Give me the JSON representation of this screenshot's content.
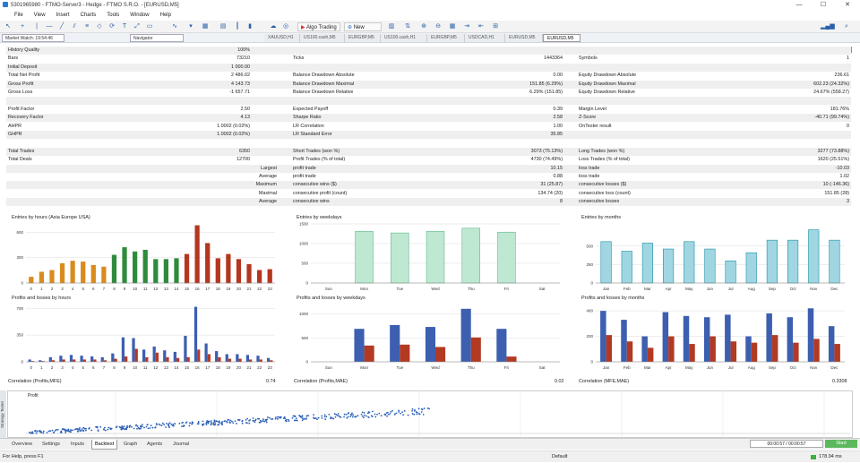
{
  "window": {
    "title": "5301965980 - FTMO-Server3 - Hedge - FTMO S.R.O. - [EURUSD,M5]",
    "controls": [
      "—",
      "☐",
      "✕"
    ]
  },
  "menu": [
    "File",
    "View",
    "Insert",
    "Charts",
    "Tools",
    "Window",
    "Help"
  ],
  "toolbar": {
    "algo_trading": "Algo Trading",
    "new_order": "New Order"
  },
  "panes": {
    "market_watch": "Market Watch: 19:54:46",
    "navigator": "Navigator"
  },
  "chart_tabs": [
    "XAUUSD,H1",
    "US100.cash,M5",
    "EURGBP,M5",
    "US100.cash,H1",
    "EURGBP,M5",
    "USDCAD,H1",
    "EURUSD,M5",
    "EURUSD,M5"
  ],
  "active_chart_tab": 7,
  "report": {
    "rows": [
      {
        "c1": [
          "History Quality",
          "100%"
        ],
        "c2": [
          "",
          ""
        ],
        "c3": [
          "",
          ""
        ]
      },
      {
        "c1": [
          "Bars",
          "73210"
        ],
        "c2": [
          "Ticks",
          "1443364"
        ],
        "c3": [
          "Symbols",
          "1"
        ]
      },
      {
        "c1": [
          "Initial Deposit",
          "1 000.00"
        ],
        "c2": [
          "",
          ""
        ],
        "c3": [
          "",
          ""
        ]
      },
      {
        "c1": [
          "Total Net Profit",
          "2 486.02"
        ],
        "c2": [
          "Balance Drawdown Absolute",
          "0.00"
        ],
        "c3": [
          "Equity Drawdown Absolute",
          "236.61"
        ]
      },
      {
        "c1": [
          "Gross Profit",
          "4 143.73"
        ],
        "c2": [
          "Balance Drawdown Maximal",
          "151.85 (6.29%)"
        ],
        "c3": [
          "Equity Drawdown Maximal",
          "602.23 (24.32%)"
        ]
      },
      {
        "c1": [
          "Gross Loss",
          "-1 657.71"
        ],
        "c2": [
          "Balance Drawdown Relative",
          "6.29% (151.85)"
        ],
        "c3": [
          "Equity Drawdown Relative",
          "24.67% (558.27)"
        ]
      },
      {
        "c1": [
          "",
          ""
        ],
        "c2": [
          "",
          ""
        ],
        "c3": [
          "",
          ""
        ]
      },
      {
        "c1": [
          "Profit Factor",
          "2.50"
        ],
        "c2": [
          "Expected Payoff",
          "0.39"
        ],
        "c3": [
          "Margin Level",
          "181.76%"
        ]
      },
      {
        "c1": [
          "Recovery Factor",
          "4.13"
        ],
        "c2": [
          "Sharpe Ratio",
          "2.58"
        ],
        "c3": [
          "Z-Score",
          "-40.71 (99.74%)"
        ]
      },
      {
        "c1": [
          "AHPR",
          "1.0002 (0.02%)"
        ],
        "c2": [
          "LR Correlation",
          "1.00"
        ],
        "c3": [
          "OnTester result",
          "0"
        ]
      },
      {
        "c1": [
          "GHPR",
          "1.0002 (0.02%)"
        ],
        "c2": [
          "LR Standard Error",
          "35.85"
        ],
        "c3": [
          "",
          ""
        ]
      },
      {
        "c1": [
          "",
          ""
        ],
        "c2": [
          "",
          ""
        ],
        "c3": [
          "",
          ""
        ]
      },
      {
        "c1": [
          "Total Trades",
          "6350"
        ],
        "c2": [
          "Short Trades (won %)",
          "3073 (75.13%)"
        ],
        "c3": [
          "Long Trades (won %)",
          "3277 (73.88%)"
        ]
      },
      {
        "c1": [
          "Total Deals",
          "12700"
        ],
        "c2": [
          "Profit Trades (% of total)",
          "4730 (74.49%)"
        ],
        "c3": [
          "Loss Trades (% of total)",
          "1620 (25.51%)"
        ]
      },
      {
        "c1": [
          "Largest",
          ""
        ],
        "c2": [
          "profit trade",
          "10.15"
        ],
        "c3": [
          "loss trade",
          "-10.03"
        ]
      },
      {
        "c1": [
          "Average",
          ""
        ],
        "c2": [
          "profit trade",
          "0.88"
        ],
        "c3": [
          "loss trade",
          "1.02"
        ]
      },
      {
        "c1": [
          "Maximum",
          ""
        ],
        "c2": [
          "consecutive wins ($)",
          "31 (25.87)"
        ],
        "c3": [
          "consecutive losses ($)",
          "10 (-146.36)"
        ]
      },
      {
        "c1": [
          "Maximal",
          ""
        ],
        "c2": [
          "consecutive profit (count)",
          "134.74 (20)"
        ],
        "c3": [
          "consecutive loss (count)",
          "151.85 (28)"
        ]
      },
      {
        "c1": [
          "Average",
          ""
        ],
        "c2": [
          "consecutive wins",
          "8"
        ],
        "c3": [
          "consecutive losses",
          "3"
        ]
      }
    ]
  },
  "colors": {
    "orange": "#d98b1e",
    "green": "#2e8b3c",
    "red": "#b5361f",
    "teal_green": "#5fb88a",
    "teal": "#1e90a6",
    "blue": "#3c5fb0",
    "dark_red": "#b23a23",
    "history_bar": "#7ed67e"
  },
  "chart_data": [
    {
      "type": "bar",
      "title": "Entries by hours (Asia Europe USA)",
      "categories": [
        "0",
        "1",
        "2",
        "3",
        "4",
        "5",
        "6",
        "7",
        "8",
        "9",
        "10",
        "11",
        "12",
        "13",
        "14",
        "15",
        "16",
        "17",
        "18",
        "19",
        "20",
        "21",
        "22",
        "23"
      ],
      "values": [
        70,
        130,
        150,
        230,
        260,
        250,
        210,
        190,
        330,
        420,
        370,
        390,
        280,
        280,
        290,
        340,
        680,
        470,
        290,
        340,
        280,
        220,
        150,
        160
      ],
      "colors_by_index": [
        "orange",
        "orange",
        "orange",
        "orange",
        "orange",
        "orange",
        "orange",
        "orange",
        "green",
        "green",
        "green",
        "green",
        "green",
        "green",
        "green",
        "red",
        "red",
        "red",
        "red",
        "red",
        "red",
        "red",
        "red",
        "red"
      ],
      "yticks": [
        "0",
        "300",
        "600"
      ],
      "ylim": [
        0,
        700
      ]
    },
    {
      "type": "bar",
      "title": "Entries by weekdays",
      "categories": [
        "Sun",
        "Mon",
        "Tue",
        "Wed",
        "Thu",
        "Fri",
        "Sat"
      ],
      "values": [
        0,
        1310,
        1270,
        1310,
        1390,
        1290,
        0
      ],
      "yticks": [
        "0",
        "500",
        "1000",
        "1500"
      ],
      "ylim": [
        0,
        1500
      ]
    },
    {
      "type": "bar",
      "title": "Entries by months",
      "categories": [
        "Jan",
        "Feb",
        "Mar",
        "Apr",
        "May",
        "Jun",
        "Jul",
        "Aug",
        "Sep",
        "Oct",
        "Nov",
        "Dec"
      ],
      "values": [
        560,
        430,
        540,
        460,
        560,
        460,
        300,
        410,
        580,
        580,
        720,
        580
      ],
      "yticks": [
        "0",
        "250",
        "500"
      ],
      "ylim": [
        0,
        800
      ]
    },
    {
      "type": "bar",
      "title": "Profits and losses by hours",
      "categories": [
        "0",
        "1",
        "2",
        "3",
        "4",
        "5",
        "6",
        "7",
        "8",
        "9",
        "10",
        "11",
        "12",
        "13",
        "14",
        "15",
        "16",
        "17",
        "18",
        "19",
        "20",
        "21",
        "22",
        "23"
      ],
      "series": [
        {
          "values": [
            30,
            20,
            60,
            80,
            90,
            80,
            70,
            60,
            110,
            320,
            310,
            160,
            200,
            150,
            130,
            340,
            720,
            240,
            140,
            100,
            100,
            90,
            80,
            50
          ]
        },
        {
          "values": [
            10,
            10,
            20,
            30,
            30,
            30,
            30,
            20,
            40,
            70,
            170,
            60,
            120,
            60,
            50,
            60,
            160,
            100,
            60,
            40,
            40,
            30,
            30,
            20
          ]
        }
      ],
      "yticks": [
        "0",
        "350",
        "700"
      ],
      "ylim": [
        0,
        750
      ]
    },
    {
      "type": "bar",
      "title": "Profits and losses by weekdays",
      "categories": [
        "Sun",
        "Mon",
        "Tue",
        "Wed",
        "Thu",
        "Fri",
        "Sat"
      ],
      "series": [
        {
          "values": [
            0,
            690,
            770,
            730,
            1110,
            690,
            0
          ]
        },
        {
          "values": [
            0,
            340,
            360,
            310,
            510,
            110,
            0
          ]
        }
      ],
      "yticks": [
        "0",
        "500",
        "1000"
      ],
      "ylim": [
        0,
        1200
      ]
    },
    {
      "type": "bar",
      "title": "Profits and losses by months",
      "categories": [
        "Jan",
        "Feb",
        "Mar",
        "Apr",
        "May",
        "Jun",
        "Jul",
        "Aug",
        "Sep",
        "Oct",
        "Nov",
        "Dec"
      ],
      "series": [
        {
          "values": [
            400,
            330,
            200,
            390,
            360,
            350,
            370,
            200,
            380,
            350,
            420,
            280
          ]
        },
        {
          "values": [
            210,
            160,
            110,
            200,
            140,
            200,
            160,
            150,
            210,
            150,
            180,
            140
          ]
        }
      ],
      "yticks": [
        "0",
        "200",
        "400"
      ],
      "ylim": [
        0,
        450
      ]
    }
  ],
  "correlations": [
    {
      "label": "Correlation (Profits,MFE)",
      "value": "0.74"
    },
    {
      "label": "Correlation (Profits,MAE)",
      "value": "0.02"
    },
    {
      "label": "Correlation (MFE,MAE)",
      "value": "0.3308"
    }
  ],
  "scatter": {
    "label": "Profit"
  },
  "bottom_tabs": [
    "Overview",
    "Settings",
    "Inputs",
    "Backtest",
    "Graph",
    "Agents",
    "Journal"
  ],
  "active_bottom_tab": 3,
  "side_tab": "Strategy Tester",
  "timer": "00:00:57 / 00:00:57",
  "start_button": "Start",
  "status": {
    "help": "For Help, press F1",
    "profile": "Default",
    "ping": "178.94 ms"
  }
}
